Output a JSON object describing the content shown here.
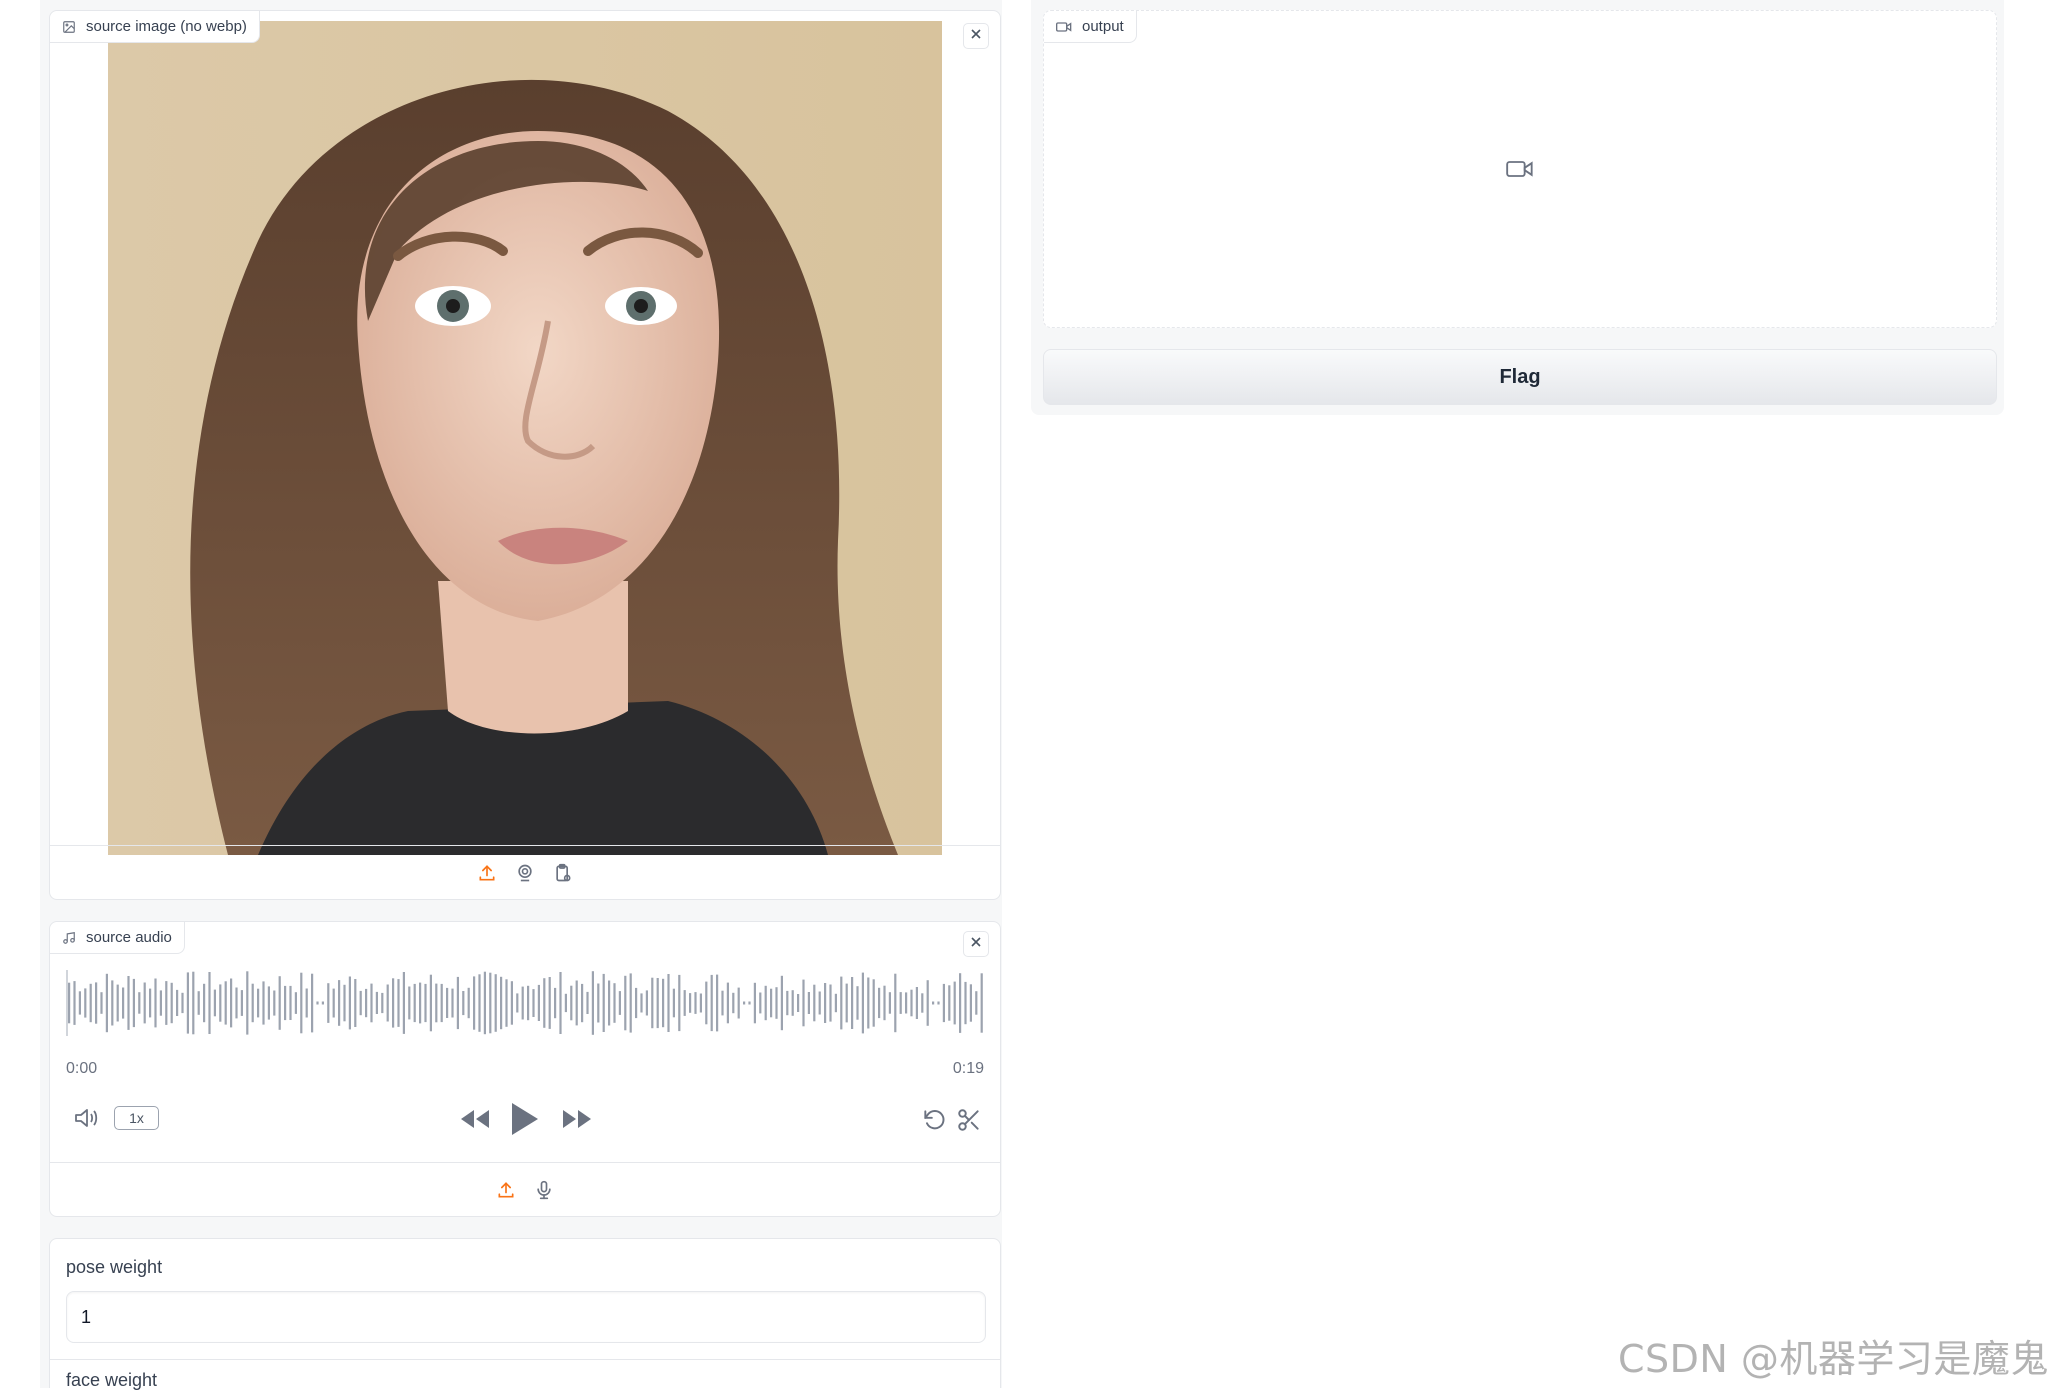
{
  "image_input": {
    "label": "source image (no webp)",
    "sources": [
      "upload-icon",
      "webcam-icon",
      "clipboard-icon"
    ]
  },
  "audio_input": {
    "label": "source audio",
    "current_time": "0:00",
    "duration": "0:19",
    "speed_label": "1x",
    "sources": [
      "upload-icon",
      "microphone-icon"
    ]
  },
  "pose_weight": {
    "label": "pose weight",
    "value": "1"
  },
  "face_weight": {
    "label": "face weight"
  },
  "output": {
    "label": "output"
  },
  "flag_button": {
    "label": "Flag"
  },
  "watermark": "CSDN @机器学习是魔鬼",
  "colors": {
    "accent": "#f97316",
    "waveform": "#9ca3af",
    "panel_bg": "#f6f7f8"
  }
}
